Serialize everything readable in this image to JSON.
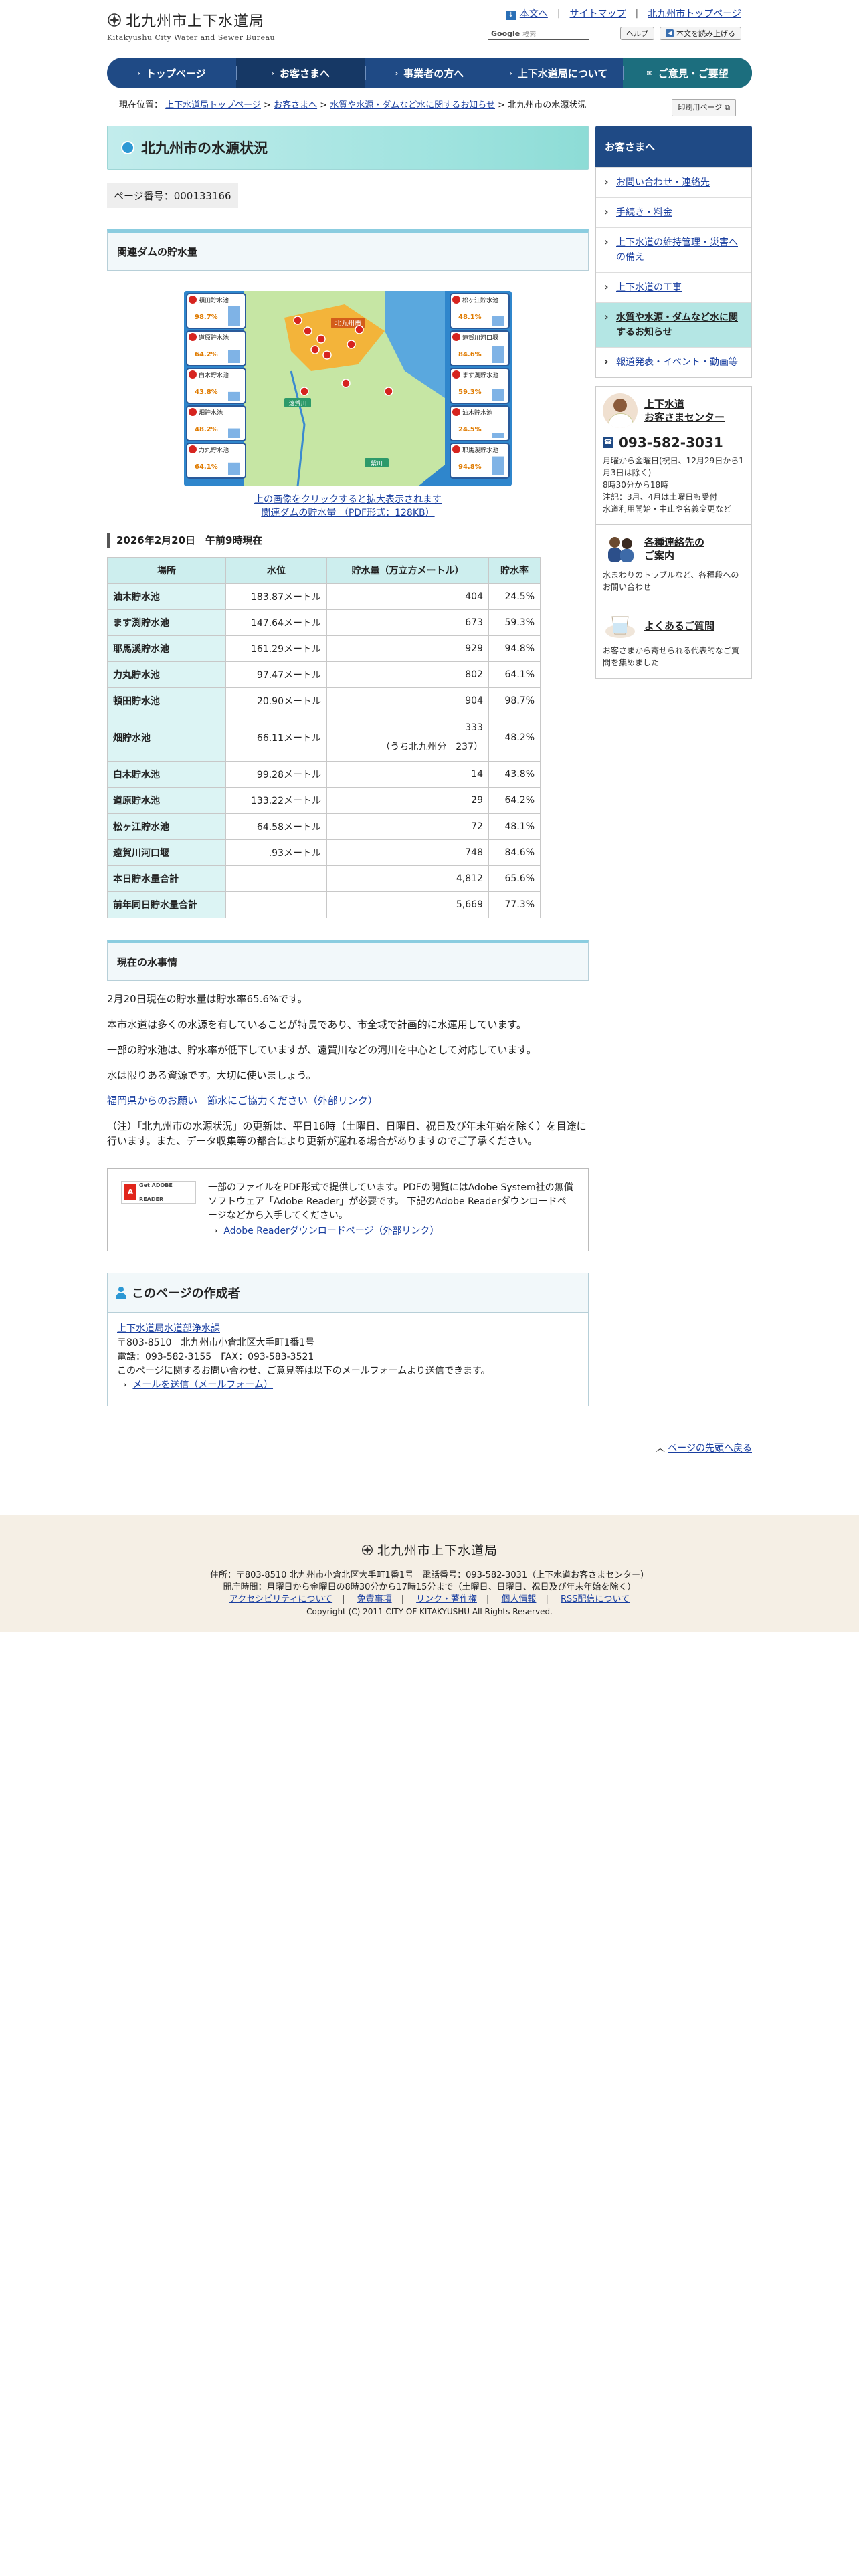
{
  "header": {
    "logo_title": "北九州市上下水道局",
    "logo_sub": "Kitakyushu City Water and Sewer Bureau",
    "links": [
      "本文へ",
      "サイトマップ",
      "北九州市トップページ"
    ],
    "search_brand": "Google",
    "search_placeholder": "検索",
    "help_label": "ヘルプ",
    "read_label": "本文を読み上げる"
  },
  "nav": [
    "トップページ",
    "お客さまへ",
    "事業者の方へ",
    "上下水道局について",
    "ご意見・ご要望"
  ],
  "breadcrumb": {
    "prefix": "現在位置：",
    "items": [
      "上下水道局トップページ",
      "お客さまへ",
      "水質や水源・ダムなど水に関するお知らせ"
    ],
    "current": "北九州市の水源状況",
    "print_label": "印刷用ページ"
  },
  "page": {
    "title": "北九州市の水源状況",
    "page_number": "ページ番号：000133166",
    "section1": "関連ダムの貯水量",
    "map_caption1": "上の画像をクリックすると拡大表示されます",
    "map_caption2": "関連ダムの貯水量 （PDF形式：128KB）",
    "date_heading": "2026年2月20日　午前9時現在"
  },
  "map": {
    "labels": [
      "頓田貯水池",
      "道原貯水池",
      "白木貯水池",
      "畑貯水池",
      "力丸貯水池",
      "松ヶ江貯水池",
      "遠賀川河口堰",
      "ます渕貯水池",
      "油木貯水池",
      "耶馬溪貯水池"
    ],
    "percents": [
      "98.7%",
      "64.2%",
      "43.8%",
      "48.2%",
      "64.1%",
      "48.1%",
      "84.6%",
      "59.3%",
      "24.5%",
      "94.8%"
    ],
    "city": "北九州市",
    "river": "遠賀川",
    "river2": "紫川"
  },
  "table": {
    "headers": [
      "場所",
      "水位",
      "貯水量（万立方メートル）",
      "貯水率"
    ],
    "rows": [
      {
        "name": "油木貯水池",
        "level": "183.87メートル",
        "volume": "404",
        "rate": "24.5%"
      },
      {
        "name": "ます渕貯水池",
        "level": "147.64メートル",
        "volume": "673",
        "rate": "59.3%"
      },
      {
        "name": "耶馬溪貯水池",
        "level": "161.29メートル",
        "volume": "929",
        "rate": "94.8%"
      },
      {
        "name": "力丸貯水池",
        "level": "97.47メートル",
        "volume": "802",
        "rate": "64.1%"
      },
      {
        "name": "頓田貯水池",
        "level": "20.90メートル",
        "volume": "904",
        "rate": "98.7%"
      },
      {
        "name": "畑貯水池",
        "level": "66.11メートル",
        "volume": "333",
        "volume_sub": "（うち北九州分　237）",
        "rate": "48.2%"
      },
      {
        "name": "白木貯水池",
        "level": "99.28メートル",
        "volume": "14",
        "rate": "43.8%"
      },
      {
        "name": "道原貯水池",
        "level": "133.22メートル",
        "volume": "29",
        "rate": "64.2%"
      },
      {
        "name": "松ヶ江貯水池",
        "level": "64.58メートル",
        "volume": "72",
        "rate": "48.1%"
      },
      {
        "name": "遠賀川河口堰",
        "level": ".93メートル",
        "volume": "748",
        "rate": "84.6%"
      },
      {
        "name": "本日貯水量合計",
        "level": "",
        "volume": "4,812",
        "rate": "65.6%"
      },
      {
        "name": "前年同日貯水量合計",
        "level": "",
        "volume": "5,669",
        "rate": "77.3%"
      }
    ]
  },
  "water": {
    "heading": "現在の水事情",
    "p1": "2月20日現在の貯水量は貯水率65.6%です。",
    "p2": "本市水道は多くの水源を有していることが特長であり、市全域で計画的に水運用しています。",
    "p3": "一部の貯水池は、貯水率が低下していますが、遠賀川などの河川を中心として対応しています。",
    "p4": "水は限りある資源です。大切に使いましょう。",
    "link": "福岡県からのお願い　節水にご協力ください（外部リンク）",
    "note": "（注）「北九州市の水源状況」の更新は、平日16時（土曜日、日曜日、祝日及び年末年始を除く）を目途に行います。また、データ収集等の都合により更新が遅れる場合がありますのでご了承ください。"
  },
  "pdf": {
    "badge": "Get ADOBE READER",
    "text": "一部のファイルをPDF形式で提供しています。PDFの閲覧にはAdobe System社の無償ソフトウェア「Adobe Reader」が必要です。 下記のAdobe Readerダウンロードページなどから入手してください。",
    "link": "Adobe Readerダウンロードページ（外部リンク）"
  },
  "author": {
    "heading": "このページの作成者",
    "dept": "上下水道局水道部浄水課",
    "address": "〒803-8510　北九州市小倉北区大手町1番1号",
    "phone": "電話：093-582-3155　FAX：093-583-3521",
    "note": "このページに関するお問い合わせ、ご意見等は以下のメールフォームより送信できます。",
    "mail_link": "メールを送信（メールフォーム）"
  },
  "totop": "ページの先頭へ戻る",
  "sidebar": {
    "heading": "お客さまへ",
    "items": [
      "お問い合わせ・連絡先",
      "手続き・料金",
      "上下水道の維持管理・災害への備え",
      "上下水道の工事",
      "水質や水源・ダムなど水に関するお知らせ",
      "報道発表・イベント・動画等"
    ],
    "center_title": "上下水道\nお客さまセンター",
    "center_tel": "093-582-3031",
    "center_hours": "月曜から金曜日(祝日、12月29日から1月3日は除く)\n8時30分から18時\n注記：3月、4月は土曜日も受付\n水道利用開始・中止や名義変更など",
    "contacts_title": "各種連絡先の\nご案内",
    "contacts_text": "水まわりのトラブルなど、各種段へのお問い合わせ",
    "faq_title": "よくあるご質問",
    "faq_text": "お客さまから寄せられる代表的なご質問を集めました"
  },
  "footer": {
    "logo": "北九州市上下水道局",
    "address": "住所：〒803-8510 北九州市小倉北区大手町1番1号　電話番号：093-582-3031（上下水道お客さまセンター）",
    "hours": "開庁時間：月曜日から金曜日の8時30分から17時15分まで（土曜日、日曜日、祝日及び年末年始を除く）",
    "links": [
      "アクセシビリティについて",
      "免責事項",
      "リンク・著作権",
      "個人情報",
      "RSS配信について"
    ],
    "copyright": "Copyright (C) 2011 CITY OF KITAKYUSHU All Rights Reserved."
  }
}
